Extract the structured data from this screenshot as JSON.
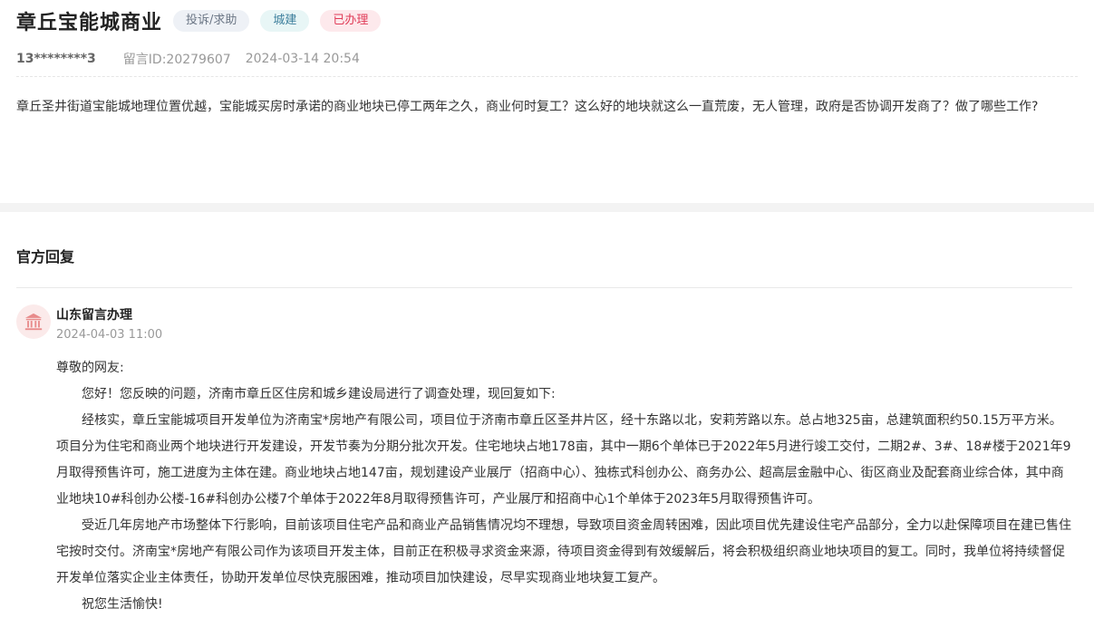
{
  "post": {
    "title": "章丘宝能城商业",
    "tags": {
      "type": "投诉/求助",
      "department": "城建",
      "status": "已办理"
    },
    "user": "13********3",
    "message_id": "留言ID:20279607",
    "datetime": "2024-03-14 20:54",
    "content": "章丘圣井街道宝能城地理位置优越，宝能城买房时承诺的商业地块已停工两年之久，商业何时复工？这么好的地块就这么一直荒废，无人管理，政府是否协调开发商了？做了哪些工作?"
  },
  "reply": {
    "section_title": "官方回复",
    "responder_name": "山东留言办理",
    "responder_time": "2024-04-03 11:00",
    "avatar_icon": "government-building-icon",
    "greeting": "尊敬的网友:",
    "paragraphs": [
      "您好！您反映的问题，济南市章丘区住房和城乡建设局进行了调查处理，现回复如下:",
      "经核实，章丘宝能城项目开发单位为济南宝*房地产有限公司，项目位于济南市章丘区圣井片区，经十东路以北，安莉芳路以东。总占地325亩，总建筑面积约50.15万平方米。项目分为住宅和商业两个地块进行开发建设，开发节奏为分期分批次开发。住宅地块占地178亩，其中一期6个单体已于2022年5月进行竣工交付，二期2#、3#、18#楼于2021年9月取得预售许可，施工进度为主体在建。商业地块占地147亩，规划建设产业展厅（招商中心）、独栋式科创办公、商务办公、超高层金融中心、街区商业及配套商业综合体，其中商业地块10#科创办公楼-16#科创办公楼7个单体于2022年8月取得预售许可，产业展厅和招商中心1个单体于2023年5月取得预售许可。",
      "受近几年房地产市场整体下行影响，目前该项目住宅产品和商业产品销售情况均不理想，导致项目资金周转困难，因此项目优先建设住宅产品部分，全力以赴保障项目在建已售住宅按时交付。济南宝*房地产有限公司作为该项目开发主体，目前正在积极寻求资金来源，待项目资金得到有效缓解后，将会积极组织商业地块项目的复工。同时，我单位将持续督促开发单位落实企业主体责任，协助开发单位尽快克服困难，推动项目加快建设，尽早实现商业地块复工复产。",
      "祝您生活愉快!"
    ]
  },
  "colors": {
    "status_red": "#e03b57",
    "dept_teal": "#3d7f9c",
    "type_gray": "#6b7685"
  }
}
